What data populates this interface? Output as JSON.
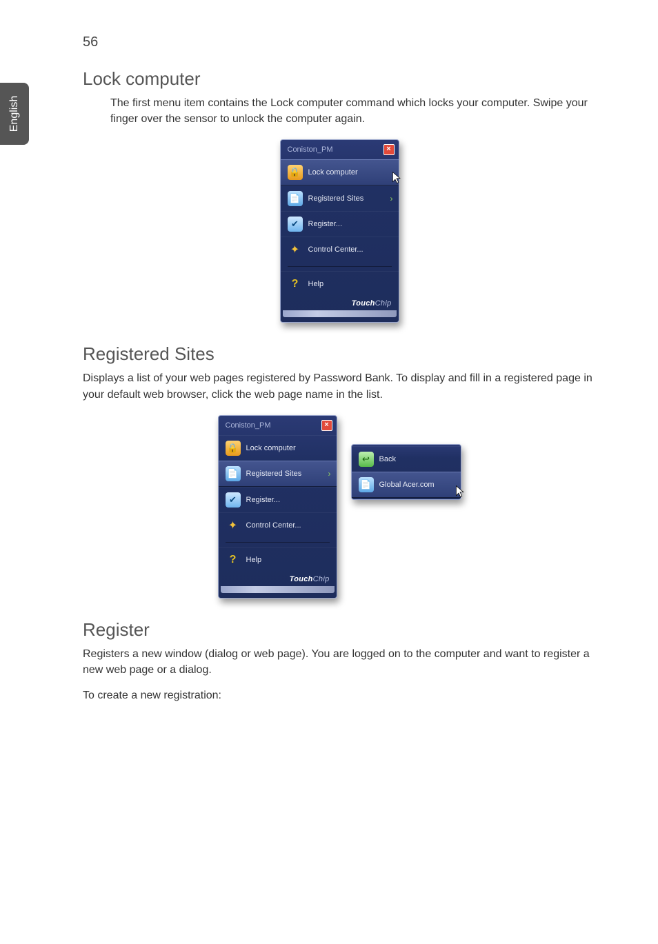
{
  "meta": {
    "page_number": "56",
    "side_tab": "English"
  },
  "sections": {
    "lock": {
      "heading": "Lock computer",
      "body": "The first menu item contains the Lock computer command which locks your computer. Swipe your finger over the sensor to unlock the computer again."
    },
    "registered": {
      "heading": "Registered Sites",
      "body": "Displays a list of your web pages registered by Password Bank. To display and fill in a registered page in your default web browser, click the web page name in the list."
    },
    "register": {
      "heading": "Register",
      "body1": "Registers a new window (dialog or web page). You are logged on to the computer and want to register a new web page or a dialog.",
      "body2": "To create a new registration:"
    }
  },
  "panel": {
    "title": "Coniston_PM",
    "close_glyph": "×",
    "items": {
      "lock": "Lock computer",
      "sites": "Registered Sites",
      "register": "Register...",
      "cc": "Control Center...",
      "help": "Help"
    },
    "brand1": "Touch",
    "brand2": "Chip",
    "arrow_glyph": "›"
  },
  "flyout": {
    "back": "Back",
    "site1": "Global Acer.com"
  },
  "icons": {
    "lock": "🔒",
    "sites": "📄",
    "register": "✔",
    "cc": "✦",
    "help": "?",
    "back": "↩",
    "cursor": "↖"
  }
}
